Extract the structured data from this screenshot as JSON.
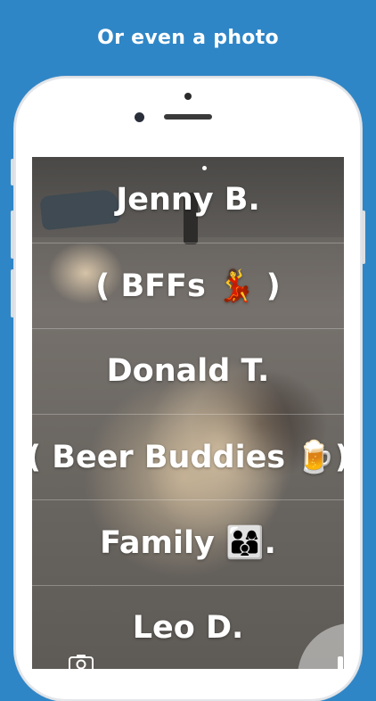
{
  "caption": "Or even a photo",
  "list": {
    "items": [
      {
        "label": "Jenny B."
      },
      {
        "label": "( BFFs 💃 )"
      },
      {
        "label": "Donald T."
      },
      {
        "label": "( Beer Buddies 🍺)"
      },
      {
        "label": "Family 👨‍👩‍👦."
      },
      {
        "label": "Leo D."
      }
    ]
  },
  "icons": {
    "camera_switch": "camera-switch-icon"
  }
}
